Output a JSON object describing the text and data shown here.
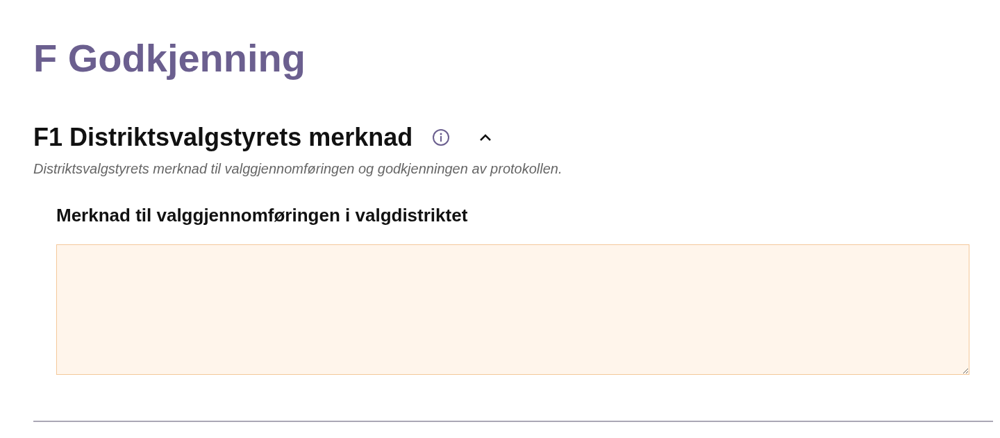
{
  "page_title": "F Godkjenning",
  "section": {
    "title": "F1 Distriktsvalgstyrets merknad",
    "expanded": true,
    "description": "Distriktsvalgstyrets merknad til valggjennomføringen og godkjenningen av protokollen.",
    "field": {
      "label": "Merknad til valggjennomføringen i valgdistriktet"
    }
  }
}
